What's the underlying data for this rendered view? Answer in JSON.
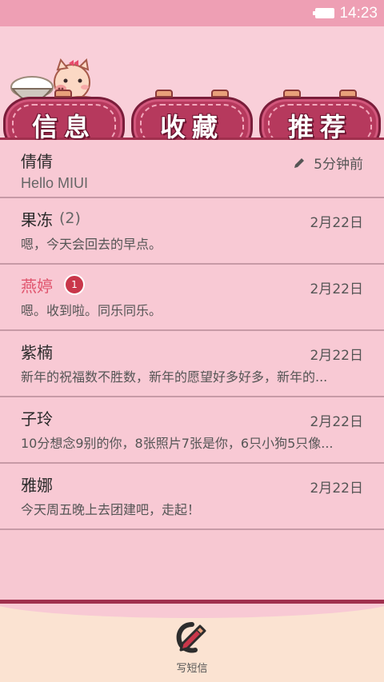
{
  "status_bar": {
    "time": "14:23",
    "battery_icon": "battery-icon"
  },
  "tabs": [
    {
      "label": "信息",
      "active": true
    },
    {
      "label": "收藏",
      "active": false
    },
    {
      "label": "推荐",
      "active": false
    }
  ],
  "conversations": [
    {
      "name": "倩倩",
      "count": "",
      "badge": "",
      "unread": false,
      "time": "5分钟前",
      "draft": true,
      "preview": "Hello MIUI"
    },
    {
      "name": "果冻",
      "count": "(2)",
      "badge": "",
      "unread": false,
      "time": "2月22日",
      "draft": false,
      "preview": "嗯，今天会回去的早点。"
    },
    {
      "name": "燕婷",
      "count": "",
      "badge": "1",
      "unread": true,
      "time": "2月22日",
      "draft": false,
      "preview": "嗯。收到啦。同乐同乐。"
    },
    {
      "name": "紫楠",
      "count": "",
      "badge": "",
      "unread": false,
      "time": "2月22日",
      "draft": false,
      "preview": "新年的祝福数不胜数，新年的愿望好多好多，新年的..."
    },
    {
      "name": "子玲",
      "count": "",
      "badge": "",
      "unread": false,
      "time": "2月22日",
      "draft": false,
      "preview": "10分想念9别的你，8张照片7张是你，6只小狗5只像..."
    },
    {
      "name": "雅娜",
      "count": "",
      "badge": "",
      "unread": false,
      "time": "2月22日",
      "draft": false,
      "preview": "今天周五晚上去团建吧，走起！"
    }
  ],
  "compose": {
    "label": "写短信",
    "icon": "compose-icon"
  },
  "colors": {
    "status_bar": "#ee9fb4",
    "background": "#f8c9d4",
    "tab_fill": "#b6395d",
    "accent_line": "#a0304e",
    "unread_name": "#e0546d",
    "badge": "#c9374a",
    "bottom_bar": "#fbe3d2"
  }
}
